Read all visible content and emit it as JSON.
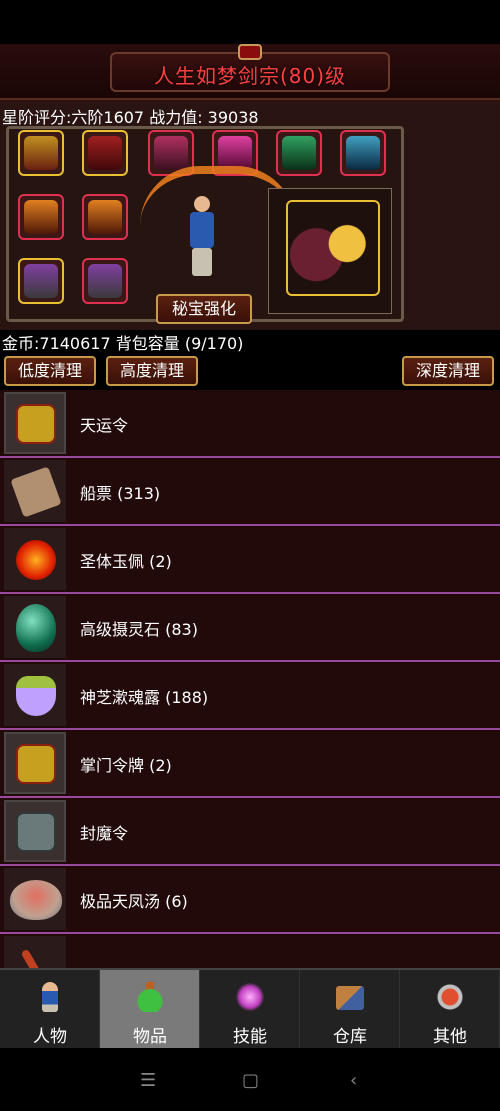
{
  "title": "人生如梦剑宗(80)级",
  "stats": {
    "score_line": "星阶评分:六阶1607 战力值: 39038"
  },
  "equipment": {
    "enhance_button": "秘宝强化"
  },
  "bag": {
    "gold_line": "金币:7140617 背包容量 (9/170)",
    "clean_low": "低度清理",
    "clean_high": "高度清理",
    "clean_deep": "深度清理",
    "items": [
      {
        "name": "天运令",
        "icon": "gold-token-icon"
      },
      {
        "name": "船票 (313)",
        "icon": "scroll-ticket-icon"
      },
      {
        "name": "圣体玉佩 (2)",
        "icon": "fire-orb-icon"
      },
      {
        "name": "高级摄灵石 (83)",
        "icon": "green-gem-icon"
      },
      {
        "name": "神芝漱魂露 (188)",
        "icon": "potion-bottle-icon"
      },
      {
        "name": "掌门令牌 (2)",
        "icon": "gold-token-icon"
      },
      {
        "name": "封魔令",
        "icon": "stone-token-icon"
      },
      {
        "name": "极品天凤汤 (6)",
        "icon": "soup-bowl-icon"
      }
    ]
  },
  "nav": {
    "tabs": [
      {
        "label": "人物",
        "icon": "character-icon"
      },
      {
        "label": "物品",
        "icon": "potion-icon"
      },
      {
        "label": "技能",
        "icon": "skill-orb-icon"
      },
      {
        "label": "仓库",
        "icon": "warehouse-icon"
      },
      {
        "label": "其他",
        "icon": "other-icon"
      }
    ],
    "active_tab": "物品"
  },
  "system_nav": {
    "menu": "☰",
    "home": "▢",
    "back": "‹"
  },
  "colors": {
    "title": "#ff4040",
    "divider": "#9a4a9a",
    "slot_red": "#e03050",
    "slot_gold": "#e8c030"
  }
}
